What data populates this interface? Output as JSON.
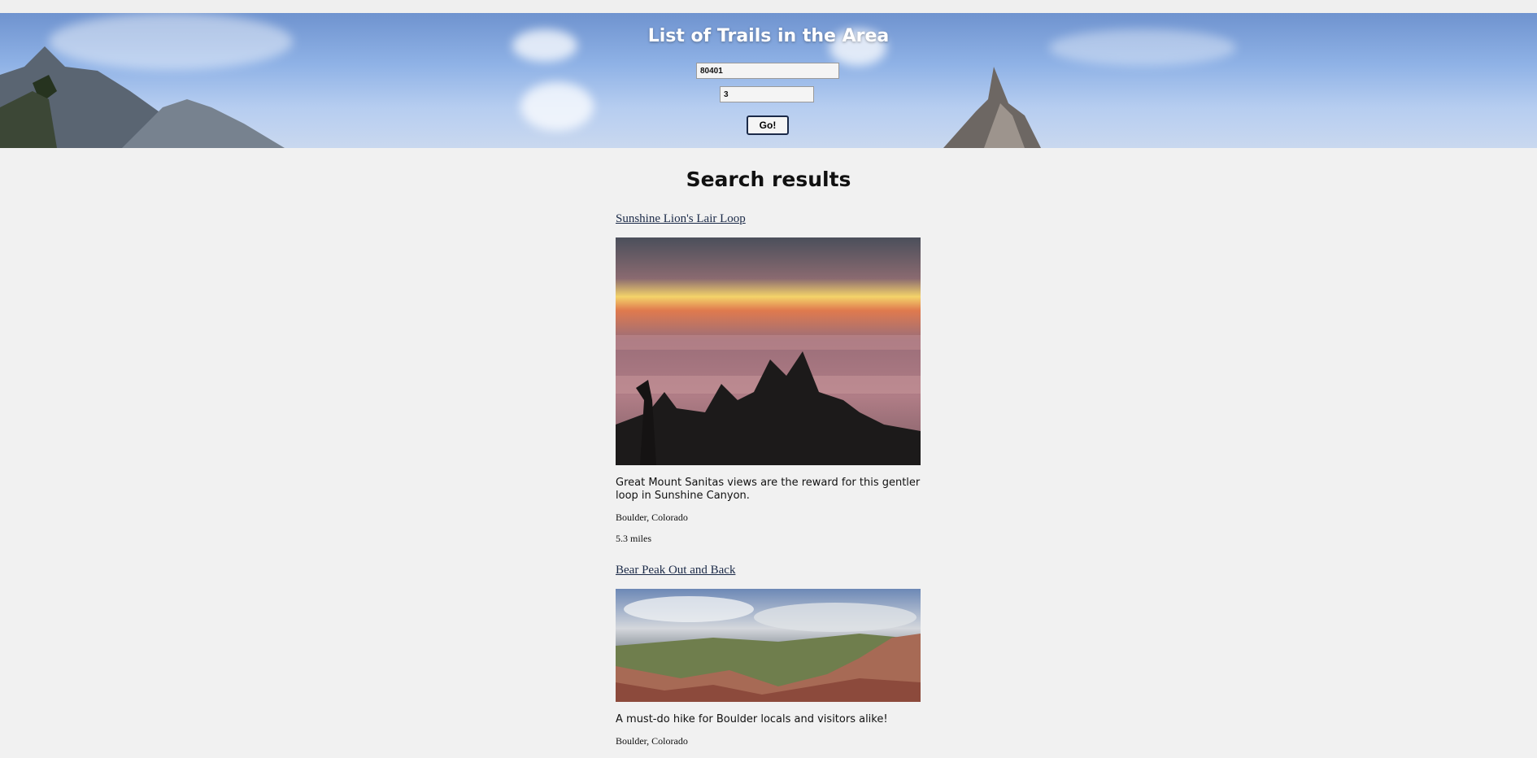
{
  "header": {
    "title": "List of Trails in the Area",
    "zip_value": "80401",
    "count_value": "3",
    "go_label": "Go!"
  },
  "results": {
    "title": "Search results",
    "trails": [
      {
        "name": "Sunshine Lion's Lair Loop",
        "summary": "Great Mount Sanitas views are the reward for this gentler loop in Sunshine Canyon.",
        "location": "Boulder, Colorado",
        "distance": "5.3 miles"
      },
      {
        "name": "Bear Peak Out and Back",
        "summary": "A must-do hike for Boulder locals and visitors alike!",
        "location": "Boulder, Colorado"
      }
    ]
  }
}
